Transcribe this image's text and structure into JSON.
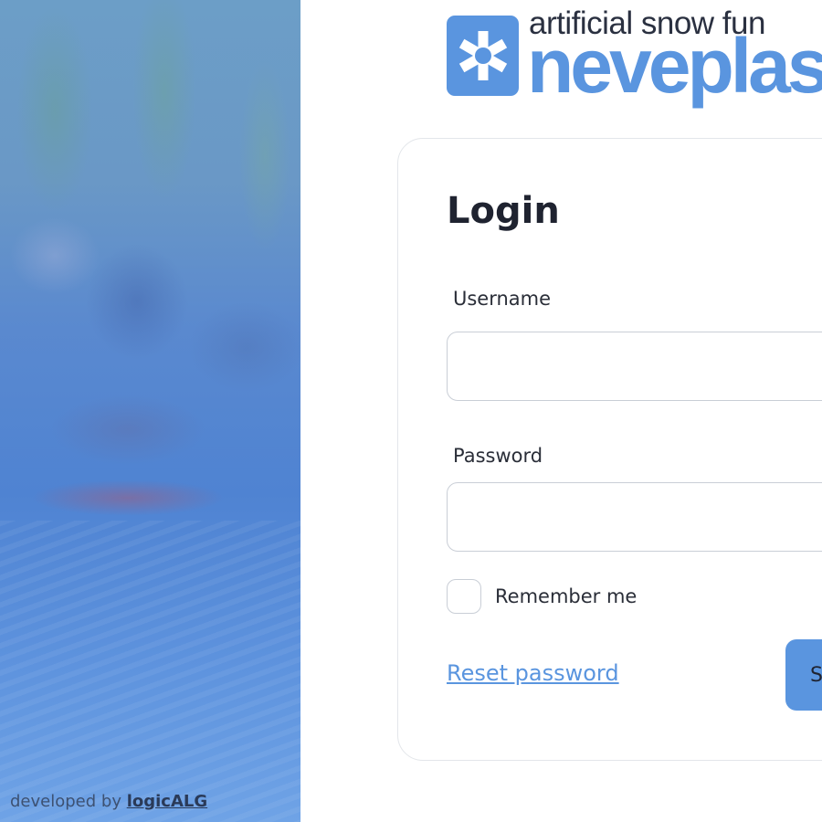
{
  "logo": {
    "tagline": "artificial snow fun",
    "brand": "neveplast",
    "color": "#5a95df",
    "icon": "snowflake-icon"
  },
  "credit": {
    "prefix": "developed by",
    "link": "logicALG"
  },
  "login": {
    "title": "Login",
    "username_label": "Username",
    "username_value": "",
    "password_label": "Password",
    "password_value": "",
    "remember_label": "Remember me",
    "remember_checked": false,
    "reset_link": "Reset password",
    "submit_label": "Submit"
  },
  "colors": {
    "accent": "#5a95df",
    "text": "#1f2330",
    "border": "#c9ced6"
  }
}
